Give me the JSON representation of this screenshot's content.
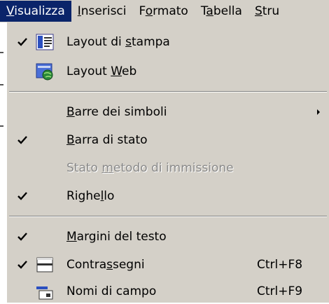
{
  "menubar": {
    "items": [
      {
        "pre": "",
        "u": "V",
        "post": "isualizza",
        "active": true
      },
      {
        "pre": "",
        "u": "I",
        "post": "nserisci",
        "active": false
      },
      {
        "pre": "F",
        "u": "o",
        "post": "rmato",
        "active": false
      },
      {
        "pre": "T",
        "u": "a",
        "post": "bella",
        "active": false
      },
      {
        "pre": "",
        "u": "S",
        "post": "tru",
        "active": false
      }
    ]
  },
  "dropdown": {
    "items": [
      {
        "pre": "Layout di ",
        "u": "s",
        "post": "tampa",
        "checked": true,
        "icon": "print-layout-icon",
        "shortcut": "",
        "submenu": false,
        "disabled": false
      },
      {
        "pre": "Layout ",
        "u": "W",
        "post": "eb",
        "checked": false,
        "icon": "web-layout-icon",
        "shortcut": "",
        "submenu": false,
        "disabled": false
      },
      {
        "pre": "",
        "u": "B",
        "post": "arre dei simboli",
        "checked": false,
        "icon": "",
        "shortcut": "",
        "submenu": true,
        "disabled": false
      },
      {
        "pre": "",
        "u": "B",
        "post": "arra di stato",
        "checked": true,
        "icon": "",
        "shortcut": "",
        "submenu": false,
        "disabled": false
      },
      {
        "pre": "Stato ",
        "u": "m",
        "post": "etodo di immissione",
        "checked": false,
        "icon": "",
        "shortcut": "",
        "submenu": false,
        "disabled": true
      },
      {
        "pre": "Righe",
        "u": "l",
        "post": "lo",
        "checked": true,
        "icon": "",
        "shortcut": "",
        "submenu": false,
        "disabled": false
      },
      {
        "pre": "",
        "u": "M",
        "post": "argini del testo",
        "checked": true,
        "icon": "",
        "shortcut": "",
        "submenu": false,
        "disabled": false
      },
      {
        "pre": "Contra",
        "u": "s",
        "post": "segni",
        "checked": true,
        "icon": "bookmarks-icon",
        "shortcut": "Ctrl+F8",
        "submenu": false,
        "disabled": false
      },
      {
        "pre": "Nomi di campo",
        "u": "",
        "post": "",
        "checked": false,
        "icon": "field-names-icon",
        "shortcut": "Ctrl+F9",
        "submenu": false,
        "disabled": false
      }
    ]
  },
  "colors": {
    "menu_bg": "#d4d0c8",
    "highlight": "#0a246a",
    "disabled_text": "#8a8a8a"
  }
}
